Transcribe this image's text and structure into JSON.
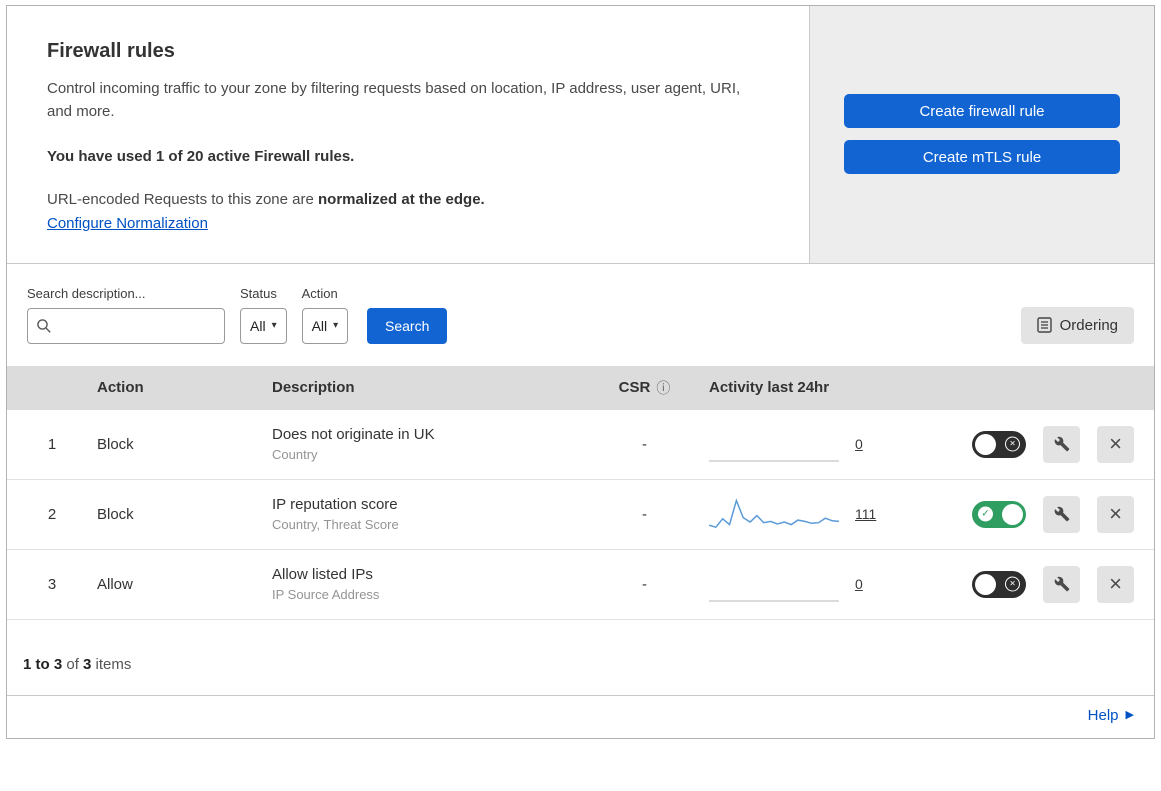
{
  "colors": {
    "accent_blue": "#1264d2",
    "link_blue": "#0051c3",
    "toggle_green": "#2f9e60",
    "spark_blue": "#5a9bd8",
    "spark_idle": "#cfcfcf"
  },
  "header": {
    "title": "Firewall rules",
    "description": "Control incoming traffic to your zone by filtering requests based on location, IP address, user agent, URI, and more.",
    "usage": "You have used 1 of 20 active Firewall rules.",
    "normalization_text": "URL-encoded Requests to this zone are ",
    "normalization_bold": "normalized at the edge.",
    "configure_link": "Configure Normalization",
    "create_firewall_button": "Create firewall rule",
    "create_mtls_button": "Create mTLS rule"
  },
  "filters": {
    "search_label": "Search description...",
    "status_label": "Status",
    "status_value": "All",
    "action_label": "Action",
    "action_value": "All",
    "search_button": "Search",
    "ordering_button": "Ordering"
  },
  "table": {
    "columns": {
      "action": "Action",
      "description": "Description",
      "csr": "CSR",
      "activity": "Activity last 24hr"
    },
    "rows": [
      {
        "index": "1",
        "action": "Block",
        "description": "Does not originate in UK",
        "subtitle": "Country",
        "csr": "-",
        "activity_count": "0",
        "enabled": false,
        "sparkline": [
          0,
          0,
          0,
          0,
          0,
          0,
          0,
          0,
          0,
          0,
          0,
          0
        ]
      },
      {
        "index": "2",
        "action": "Block",
        "description": "IP reputation score",
        "subtitle": "Country, Threat Score",
        "csr": "-",
        "activity_count": "111",
        "enabled": true,
        "sparkline": [
          0.18,
          0.12,
          0.38,
          0.2,
          0.95,
          0.42,
          0.28,
          0.48,
          0.26,
          0.3,
          0.22,
          0.28,
          0.2,
          0.34,
          0.3,
          0.24,
          0.26,
          0.4,
          0.32,
          0.3
        ]
      },
      {
        "index": "3",
        "action": "Allow",
        "description": "Allow listed IPs",
        "subtitle": "IP Source Address",
        "csr": "-",
        "activity_count": "0",
        "enabled": false,
        "sparkline": [
          0,
          0,
          0,
          0,
          0,
          0,
          0,
          0,
          0,
          0,
          0,
          0
        ]
      }
    ]
  },
  "footer": {
    "range": "1 to 3",
    "of": " of ",
    "total": "3",
    "items": " items",
    "help_label": "Help"
  },
  "icons": {
    "info": "ⓘ",
    "caret": "▾",
    "close": "×",
    "check": "✓",
    "help_arrow": "▶"
  }
}
